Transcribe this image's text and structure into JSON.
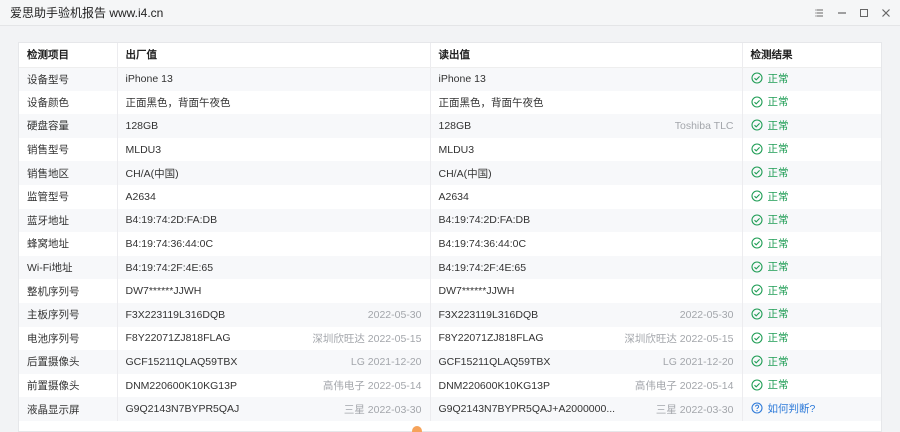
{
  "window": {
    "title": "爱思助手验机报告 www.i4.cn"
  },
  "table": {
    "headers": [
      "检测项目",
      "出厂值",
      "读出值",
      "检测结果"
    ],
    "rows": [
      {
        "item": "设备型号",
        "factory": "iPhone 13",
        "factory_extra": "",
        "read": "iPhone 13",
        "read_extra": "",
        "result": "正常",
        "status": "ok"
      },
      {
        "item": "设备颜色",
        "factory": "正面黑色，背面午夜色",
        "factory_extra": "",
        "read": "正面黑色，背面午夜色",
        "read_extra": "",
        "result": "正常",
        "status": "ok"
      },
      {
        "item": "硬盘容量",
        "factory": "128GB",
        "factory_extra": "",
        "read": "128GB",
        "read_extra": "Toshiba TLC",
        "result": "正常",
        "status": "ok"
      },
      {
        "item": "销售型号",
        "factory": "MLDU3",
        "factory_extra": "",
        "read": "MLDU3",
        "read_extra": "",
        "result": "正常",
        "status": "ok"
      },
      {
        "item": "销售地区",
        "factory": "CH/A(中国)",
        "factory_extra": "",
        "read": "CH/A(中国)",
        "read_extra": "",
        "result": "正常",
        "status": "ok"
      },
      {
        "item": "监管型号",
        "factory": "A2634",
        "factory_extra": "",
        "read": "A2634",
        "read_extra": "",
        "result": "正常",
        "status": "ok"
      },
      {
        "item": "蓝牙地址",
        "factory": "B4:19:74:2D:FA:DB",
        "factory_extra": "",
        "read": "B4:19:74:2D:FA:DB",
        "read_extra": "",
        "result": "正常",
        "status": "ok"
      },
      {
        "item": "蜂窝地址",
        "factory": "B4:19:74:36:44:0C",
        "factory_extra": "",
        "read": "B4:19:74:36:44:0C",
        "read_extra": "",
        "result": "正常",
        "status": "ok"
      },
      {
        "item": "Wi-Fi地址",
        "factory": "B4:19:74:2F:4E:65",
        "factory_extra": "",
        "read": "B4:19:74:2F:4E:65",
        "read_extra": "",
        "result": "正常",
        "status": "ok"
      },
      {
        "item": "整机序列号",
        "factory": "DW7******JJWH",
        "factory_extra": "",
        "read": "DW7******JJWH",
        "read_extra": "",
        "result": "正常",
        "status": "ok"
      },
      {
        "item": "主板序列号",
        "factory": "F3X223119L316DQB",
        "factory_extra": "2022-05-30",
        "read": "F3X223119L316DQB",
        "read_extra": "2022-05-30",
        "result": "正常",
        "status": "ok"
      },
      {
        "item": "电池序列号",
        "factory": "F8Y22071ZJ818FLAG",
        "factory_extra": "深圳欣旺达 2022-05-15",
        "read": "F8Y22071ZJ818FLAG",
        "read_extra": "深圳欣旺达 2022-05-15",
        "result": "正常",
        "status": "ok"
      },
      {
        "item": "后置摄像头",
        "factory": "GCF15211QLAQ59TBX",
        "factory_extra": "LG 2021-12-20",
        "read": "GCF15211QLAQ59TBX",
        "read_extra": "LG 2021-12-20",
        "result": "正常",
        "status": "ok"
      },
      {
        "item": "前置摄像头",
        "factory": "DNM220600K10KG13P",
        "factory_extra": "高伟电子 2022-05-14",
        "read": "DNM220600K10KG13P",
        "read_extra": "高伟电子 2022-05-14",
        "result": "正常",
        "status": "ok"
      },
      {
        "item": "液晶显示屏",
        "factory": "G9Q2143N7BYPR5QAJ",
        "factory_extra": "三星 2022-03-30",
        "read": "G9Q2143N7BYPR5QAJ+A2000000...",
        "read_extra": "三星 2022-03-30",
        "result": "如何判断?",
        "status": "help"
      }
    ]
  },
  "colors": {
    "ok": "#1f9d55",
    "help": "#2f7bd9",
    "extra": "#a3a6ab"
  }
}
